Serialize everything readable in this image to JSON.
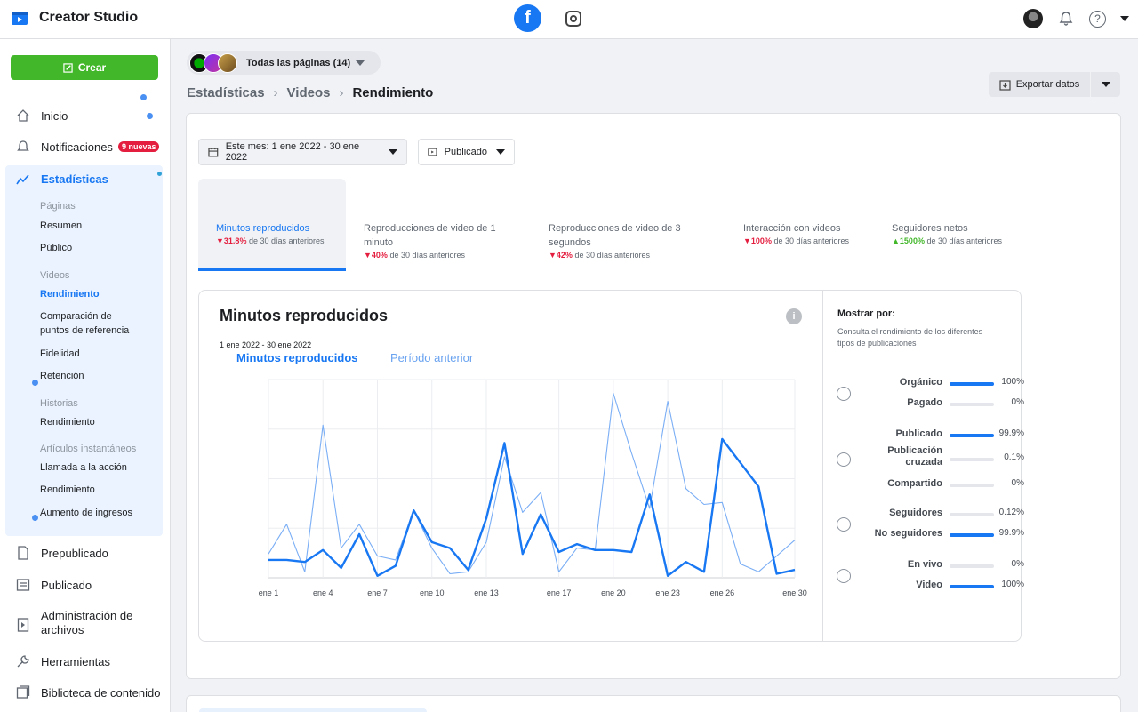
{
  "app": {
    "title": "Creator Studio"
  },
  "sidebar": {
    "create_label": "Crear",
    "inicio": "Inicio",
    "notificaciones": "Notificaciones",
    "notif_badge": "9 nuevas",
    "estadisticas": "Estadísticas",
    "paginas_group": "Páginas",
    "resumen": "Resumen",
    "publico": "Público",
    "videos_group": "Videos",
    "rendimiento": "Rendimiento",
    "comparacion_1": "Comparación de",
    "comparacion_2": "puntos de referencia",
    "fidelidad": "Fidelidad",
    "retencion": "Retención",
    "historias_group": "Historias",
    "historias_rendimiento": "Rendimiento",
    "articulos_group": "Artículos instantáneos",
    "llamada": "Llamada a la acción",
    "articulos_rendimiento": "Rendimiento",
    "aumento": "Aumento de ingresos",
    "prepublicado": "Prepublicado",
    "publicado": "Publicado",
    "admin_1": "Administración de",
    "admin_2": "archivos",
    "herramientas": "Herramientas",
    "biblioteca": "Biblioteca de contenido"
  },
  "header": {
    "page_selector": "Todas las páginas (14)",
    "breadcrumb": [
      "Estadísticas",
      "Videos",
      "Rendimiento"
    ],
    "export_label": "Exportar datos"
  },
  "filters": {
    "date_range": "Este mes: 1 ene 2022 - 30 ene 2022",
    "status": "Publicado"
  },
  "metric_tabs": [
    {
      "title_1": "Minutos reproducidos",
      "title_2": "",
      "change": "31.8%",
      "dir": "down",
      "suffix": "de 30 días anteriores"
    },
    {
      "title_1": "Reproducciones de video de 1",
      "title_2": "minuto",
      "change": "40%",
      "dir": "down",
      "suffix": "de 30 días anteriores"
    },
    {
      "title_1": "Reproducciones de video de 3",
      "title_2": "segundos",
      "change": "42%",
      "dir": "down",
      "suffix": "de 30 días anteriores"
    },
    {
      "title_1": "Interacción con videos",
      "title_2": "",
      "change": "100%",
      "dir": "down",
      "suffix": "de 30 días anteriores"
    },
    {
      "title_1": "Seguidores netos",
      "title_2": "",
      "change": "1500%",
      "dir": "up",
      "suffix": "de 30 días anteriores"
    }
  ],
  "chart_panel": {
    "title": "Minutos reproducidos",
    "range": "1 ene 2022 - 30 ene 2022",
    "legend_current": "Minutos reproducidos",
    "legend_previous": "Período anterior",
    "info_icon": "info-icon"
  },
  "chart_data": {
    "type": "line",
    "x": [
      "ene 1",
      "ene 2",
      "ene 3",
      "ene 4",
      "ene 5",
      "ene 6",
      "ene 7",
      "ene 8",
      "ene 9",
      "ene 10",
      "ene 11",
      "ene 12",
      "ene 13",
      "ene 14",
      "ene 15",
      "ene 16",
      "ene 17",
      "ene 18",
      "ene 19",
      "ene 20",
      "ene 21",
      "ene 22",
      "ene 23",
      "ene 24",
      "ene 25",
      "ene 26",
      "ene 27",
      "ene 28",
      "ene 29",
      "ene 30"
    ],
    "tick_labels": [
      "ene 1",
      "ene 4",
      "ene 7",
      "ene 10",
      "ene 13",
      "ene 17",
      "ene 20",
      "ene 23",
      "ene 26",
      "ene 30"
    ],
    "series": [
      {
        "name": "Minutos reproducidos",
        "color": "#1877f2",
        "values": [
          9,
          9,
          8,
          14,
          5,
          22,
          1,
          6,
          34,
          18,
          15,
          4,
          30,
          68,
          12,
          32,
          13,
          17,
          14,
          14,
          13,
          42,
          1,
          8,
          3,
          70,
          58,
          46,
          2,
          4
        ]
      },
      {
        "name": "Período anterior",
        "color": "#7aaef5",
        "values": [
          12,
          27,
          3,
          77,
          15,
          27,
          11,
          9,
          34,
          15,
          2,
          3,
          18,
          61,
          33,
          43,
          3,
          15,
          14,
          93,
          63,
          35,
          89,
          45,
          37,
          38,
          7,
          3,
          11,
          19
        ]
      }
    ],
    "ylim": [
      0,
      100
    ],
    "grid": true
  },
  "show_by": {
    "title": "Mostrar por:",
    "desc_1": "Consulta el rendimiento de los diferentes",
    "desc_2": "tipos de publicaciones",
    "groups": [
      {
        "rows": [
          {
            "label": "Orgánico",
            "pct": "100%",
            "value": 1.0
          },
          {
            "label": "Pagado",
            "pct": "0%",
            "value": 0
          }
        ]
      },
      {
        "rows": [
          {
            "label": "Publicado",
            "pct": "99.9%",
            "value": 0.999
          },
          {
            "label": "Publicación cruzada",
            "pct": "0.1%",
            "value": 0.001
          },
          {
            "label": "Compartido",
            "pct": "0%",
            "value": 0
          }
        ]
      },
      {
        "rows": [
          {
            "label": "Seguidores",
            "pct": "0.12%",
            "value": 0.0012
          },
          {
            "label": "No seguidores",
            "pct": "99.9%",
            "value": 0.999
          }
        ]
      },
      {
        "rows": [
          {
            "label": "En vivo",
            "pct": "0%",
            "value": 0
          },
          {
            "label": "Video",
            "pct": "100%",
            "value": 1.0
          }
        ]
      }
    ]
  },
  "colors": {
    "accent": "#1877f2",
    "create": "#42b72a",
    "negative": "#e41e3f",
    "positive": "#42b72a"
  }
}
